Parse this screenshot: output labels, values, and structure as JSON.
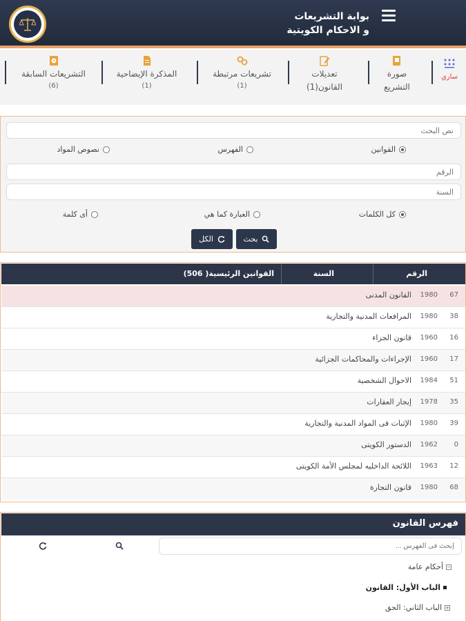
{
  "header": {
    "title_line1": "بوابة التشريعات",
    "title_line2": "و الاحكام الكويتية",
    "logo_icon": "scales-logo-icon",
    "menu_icon": "hamburger-menu-icon",
    "background": "#27303f",
    "accent": "#e9a26a"
  },
  "tabs": [
    {
      "label": "ساري",
      "sub": "",
      "icon": "hierarchy-icon",
      "active": true
    },
    {
      "label": "صورة",
      "sub": "التشريع",
      "icon": "image-doc-icon"
    },
    {
      "label": "تعديلات",
      "sub": "القانون(1)",
      "icon": "edit-doc-icon"
    },
    {
      "label": "تشريعات مرتبطة",
      "sub": "(1)",
      "icon": "link-icon"
    },
    {
      "label": "المذكرة الإيضاحية",
      "sub": "(1)",
      "icon": "memo-doc-icon"
    },
    {
      "label": "التشريعات السابقة",
      "sub": "(6)",
      "icon": "history-doc-icon"
    }
  ],
  "search": {
    "text_placeholder": "نص البحث",
    "number_placeholder": "الرقم",
    "year_placeholder": "السنة",
    "scope_options": [
      "القوانين",
      "الفهرس",
      "نصوص المواد"
    ],
    "scope_selected": "القوانين",
    "match_options": [
      "كل الكلمات",
      "العبارة كما هي",
      "أى كلمة"
    ],
    "match_selected": "كل الكلمات",
    "search_button": "بحث",
    "all_button": "الكل"
  },
  "laws_table": {
    "headers": {
      "number": "الرقم",
      "year": "السنة",
      "name": "القوانين الرئيسية( 506)"
    },
    "rows": [
      {
        "number": "67",
        "year": "1980",
        "name": "القانون المدنى"
      },
      {
        "number": "38",
        "year": "1980",
        "name": "المرافعات المدنية والتجارية"
      },
      {
        "number": "16",
        "year": "1960",
        "name": "قانون الجزاء"
      },
      {
        "number": "17",
        "year": "1960",
        "name": "الإجراءات والمحاكمات الجزائية"
      },
      {
        "number": "51",
        "year": "1984",
        "name": "الاحوال الشخصية"
      },
      {
        "number": "35",
        "year": "1978",
        "name": "إيجار العقارات"
      },
      {
        "number": "39",
        "year": "1980",
        "name": "الإثبات فى المواد المدنية والتجارية"
      },
      {
        "number": "0",
        "year": "1962",
        "name": "الدستور الكويتى"
      },
      {
        "number": "12",
        "year": "1963",
        "name": "اللائحة الداخليه لمجلس الأمة الكويتى"
      },
      {
        "number": "68",
        "year": "1980",
        "name": "قانون التجارة"
      }
    ],
    "highlight_color": "#f6e2e2"
  },
  "index": {
    "title": "فهرس القانون",
    "search_placeholder": "إبحث فى الفهرس ...",
    "tree": [
      {
        "label": "أحكام عامة",
        "marker": "⊟"
      },
      {
        "label": "الباب الأول: القانون",
        "marker": "■"
      },
      {
        "label": "الباب الثاني: الحق",
        "marker": "⊞"
      }
    ]
  }
}
